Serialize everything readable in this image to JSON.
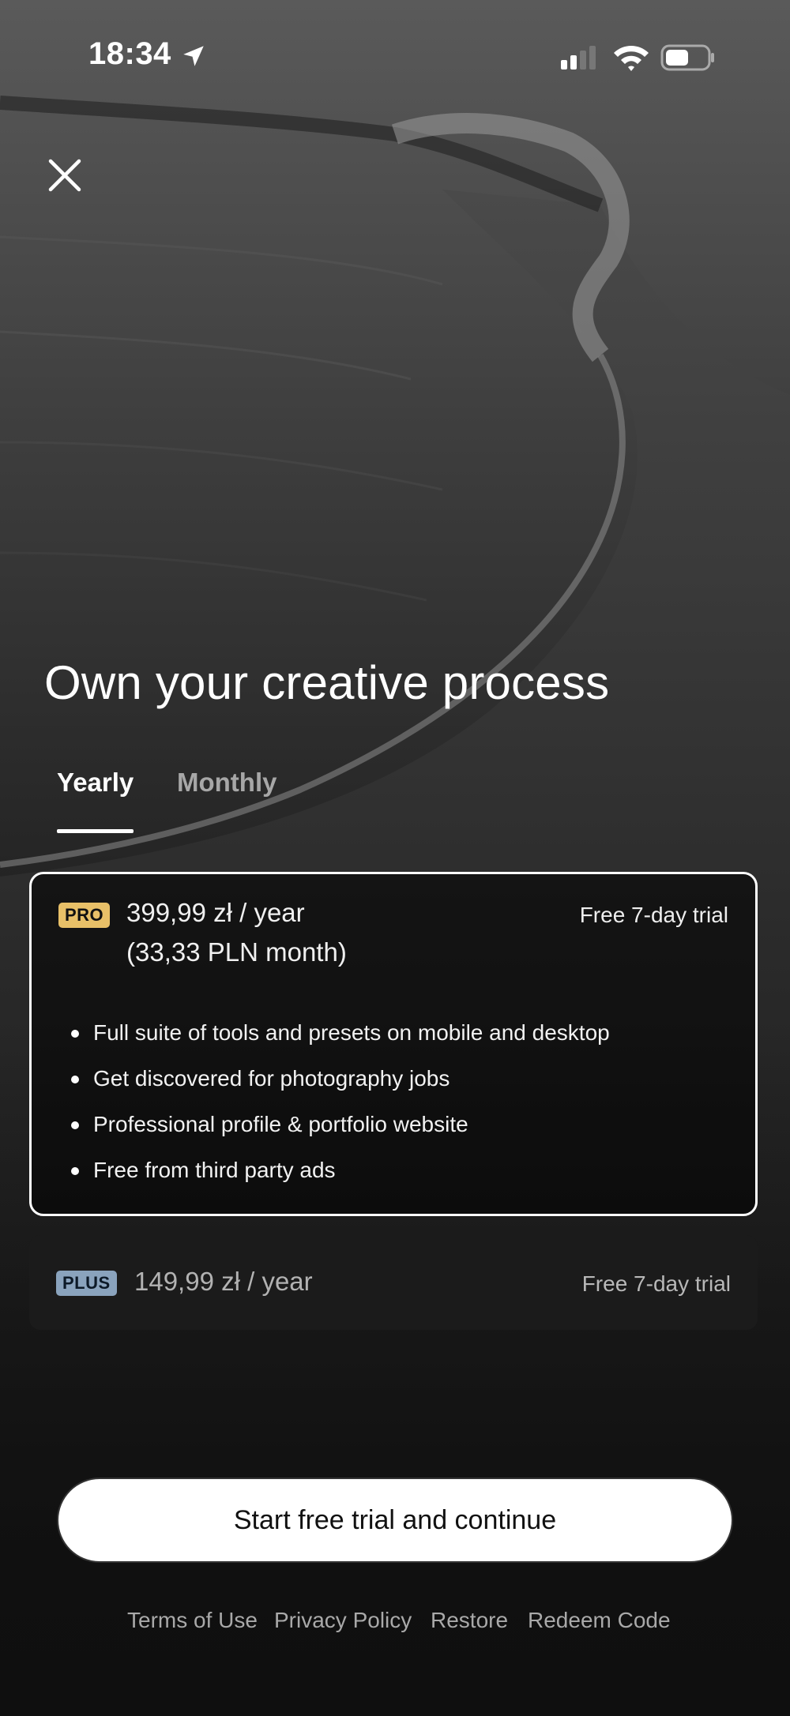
{
  "status_bar": {
    "time": "18:34",
    "icons": [
      "location-arrow-icon",
      "cellular-signal-icon",
      "wifi-icon",
      "battery-icon"
    ]
  },
  "close_icon": "close-icon",
  "headline": "Own your creative process",
  "tabs": [
    {
      "label": "Yearly",
      "selected": true
    },
    {
      "label": "Monthly",
      "selected": false
    }
  ],
  "plans": {
    "pro": {
      "badge": "PRO",
      "price": "399,99 zł / year",
      "price_monthly": "(33,33 PLN month)",
      "trial": "Free 7-day trial",
      "features": [
        "Full suite of tools and presets on mobile and desktop",
        "Get discovered for photography jobs",
        "Professional profile & portfolio website",
        "Free from third party ads"
      ],
      "selected": true
    },
    "plus": {
      "badge": "PLUS",
      "price": "149,99 zł / year",
      "trial": "Free 7-day trial",
      "selected": false
    }
  },
  "cta_label": "Start free trial and continue",
  "footer_links": [
    "Terms of Use",
    "Privacy Policy",
    "Restore",
    "Redeem Code"
  ],
  "colors": {
    "pro_badge": "#e8c068",
    "plus_badge": "#8aa3bd",
    "background": "#0f0f0f",
    "cta_background": "#ffffff"
  }
}
